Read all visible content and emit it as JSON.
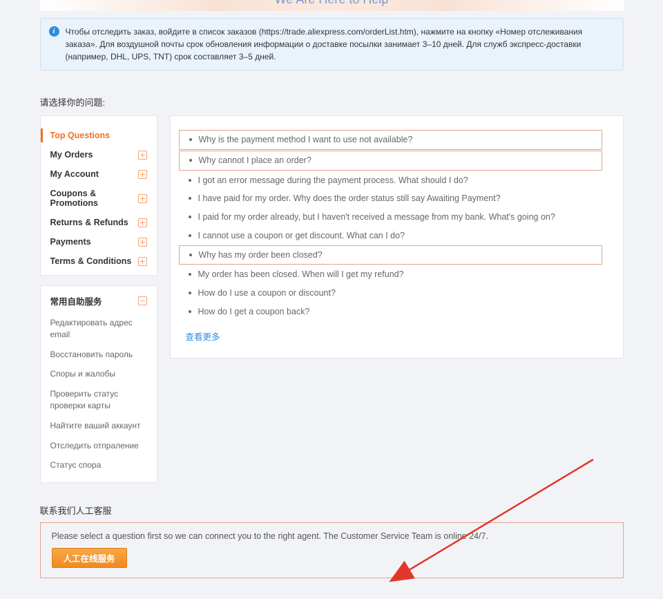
{
  "banner": {
    "tagline": "We Are Here to Help"
  },
  "notice": {
    "text": "Чтобы отследить заказ, войдите в список заказов (https://trade.aliexpress.com/orderList.htm), нажмите на кнопку «Номер отслеживания заказа». Для воздушной почты срок обновления информации о доставке посылки занимает 3–10 дней. Для служб экспресс-доставки (например, DHL, UPS, TNT) срок составляет 3–5 дней."
  },
  "select_prompt": "请选择你的问题:",
  "categories": [
    {
      "label": "Top Questions",
      "active": true,
      "icon": null
    },
    {
      "label": "My Orders",
      "active": false,
      "icon": "plus"
    },
    {
      "label": "My Account",
      "active": false,
      "icon": "plus"
    },
    {
      "label": "Coupons & Promotions",
      "active": false,
      "icon": "plus"
    },
    {
      "label": "Returns & Refunds",
      "active": false,
      "icon": "plus"
    },
    {
      "label": "Payments",
      "active": false,
      "icon": "plus"
    },
    {
      "label": "Terms & Conditions",
      "active": false,
      "icon": "plus"
    }
  ],
  "selfservice": {
    "title": "常用自助服务",
    "items": [
      "Редактировать адрес email",
      "Восстановить пароль",
      "Споры и жалобы",
      "Проверить статус проверки карты",
      "Найтите ваший аккаунт",
      "Отследить отпраление",
      "Статус спора"
    ]
  },
  "questions": [
    {
      "text": "Why is the payment method I want to use not available?",
      "highlighted": true
    },
    {
      "text": "Why cannot I place an order?",
      "highlighted": true
    },
    {
      "text": "I got an error message during the payment process. What should I do?",
      "highlighted": false
    },
    {
      "text": "I have paid for my order. Why does the order status still say Awaiting Payment?",
      "highlighted": false
    },
    {
      "text": "I paid for my order already, but I haven't received a message from my bank. What's going on?",
      "highlighted": false
    },
    {
      "text": "I cannot use a coupon or get discount. What can I do?",
      "highlighted": false
    },
    {
      "text": "Why has my order been closed?",
      "highlighted": true
    },
    {
      "text": "My order has been closed. When will I get my refund?",
      "highlighted": false
    },
    {
      "text": "How do I use a coupon or discount?",
      "highlighted": false
    },
    {
      "text": "How do I get a coupon back?",
      "highlighted": false
    }
  ],
  "see_more_label": "查看更多",
  "contact": {
    "title": "联系我们人工客服",
    "text": "Please select a question first so we can connect you to the right agent. The Customer Service Team is online 24/7.",
    "button_label": "人工在线服务"
  }
}
